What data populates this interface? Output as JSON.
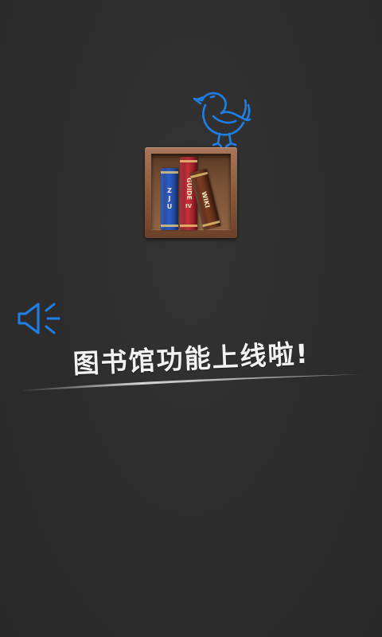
{
  "promo": {
    "headline": "图书馆功能上线啦!"
  },
  "bookshelf": {
    "books": [
      {
        "letters": [
          "Z",
          "J",
          "U"
        ],
        "color": "#2e5cc4"
      },
      {
        "title": "GUIDE",
        "volume": "IV",
        "color": "#c4303a"
      },
      {
        "title": "WIKI",
        "color": "#7a3c22"
      }
    ]
  },
  "icons": {
    "bird": "bird-doodle-icon",
    "speaker": "megaphone-icon",
    "accent_color": "#1e7fe6"
  },
  "colors": {
    "background": "#2c2c2c",
    "text": "#f2f2f2"
  }
}
